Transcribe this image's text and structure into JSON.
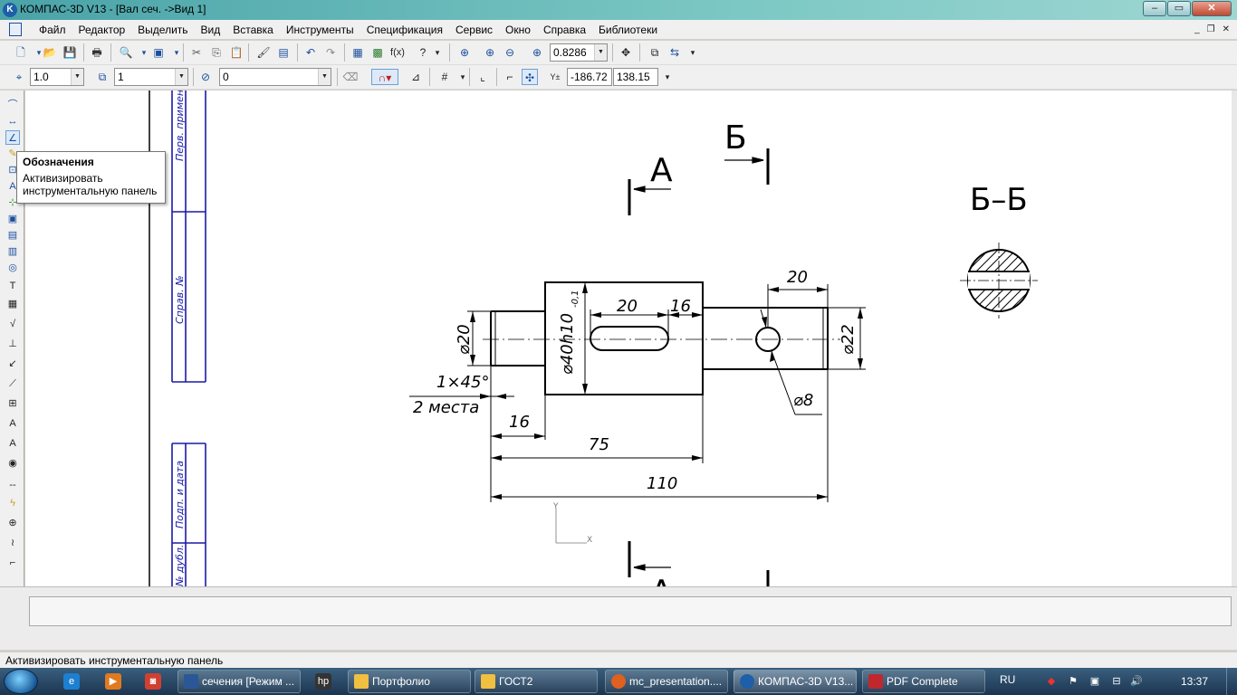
{
  "window": {
    "title": "КОМПАС-3D V13 - [Вал сеч. ->Вид 1]",
    "app_icon": "kompas-logo-icon"
  },
  "menu": {
    "items": [
      "Файл",
      "Редактор",
      "Выделить",
      "Вид",
      "Вставка",
      "Инструменты",
      "Спецификация",
      "Сервис",
      "Окно",
      "Справка",
      "Библиотеки"
    ]
  },
  "toolbar1": {
    "zoom_value": "0.8286"
  },
  "toolbar2": {
    "step_value": "1.0",
    "layer_value": "1",
    "style_value": "0",
    "coord_x": "-186.72",
    "coord_y": "138.15"
  },
  "tooltip": {
    "title": "Обозначения",
    "body_line1": "Активизировать",
    "body_line2": "инструментальную панель"
  },
  "drawing": {
    "frame_labels": [
      "Перв. примен.",
      "Справ. №",
      "Подп. и дата",
      "№ дубл."
    ],
    "section_label_a_top": "А",
    "section_label_b_top": "Б",
    "section_view_title": "Б–Б",
    "section_label_a_bottom": "А",
    "dim_20_top": "20",
    "dim_20_slot": "20",
    "dim_16_slot": "16",
    "dim_d20": "⌀20",
    "dim_d40": "⌀40h10",
    "dim_d40_tol": "-0,1",
    "dim_d22": "⌀22",
    "dim_chamfer": "1×45°",
    "dim_chamfer_note": "2 места",
    "dim_d8": "⌀8",
    "dim_16_bottom": "16",
    "dim_75": "75",
    "dim_110": "110",
    "axis_x": "X",
    "axis_y": "Y"
  },
  "status": {
    "text": "Активизировать инструментальную панель"
  },
  "taskbar": {
    "tasks": [
      {
        "label": "сечения [Режим ...",
        "color": "#2b5797"
      },
      {
        "label": "Портфолио",
        "color": "#f0c040"
      },
      {
        "label": "ГОСТ2",
        "color": "#f0c040"
      },
      {
        "label": "mc_presentation....",
        "color": "#e06020"
      },
      {
        "label": "КОМПАС-3D V13...",
        "color": "#1d5fa8"
      },
      {
        "label": "PDF Complete",
        "color": "#c0282d"
      }
    ],
    "lang": "RU",
    "clock": "13:37"
  }
}
